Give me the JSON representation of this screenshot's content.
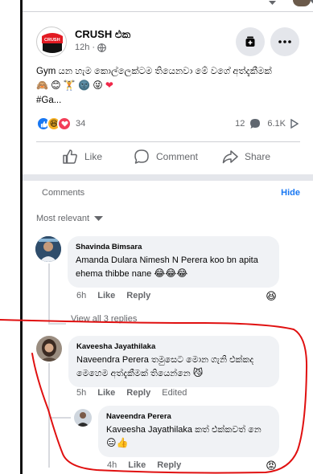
{
  "colors": {
    "accent": "#1877f2",
    "annotation": "#e01010",
    "text": "#050505",
    "muted": "#65676b",
    "bubble": "#f0f2f5"
  },
  "post": {
    "page_name": "CRUSH එක",
    "logo_text": "CRUSH",
    "time": "12h ·",
    "text": "Gym යන හැම කොල්ලෙක්ටම තියෙනවා මේ වගේ අත්දැකීමක්",
    "hashtag": "#Ga...",
    "reaction_count": "34",
    "comment_count": "12",
    "view_count": "6.1K"
  },
  "actions": {
    "like": "Like",
    "comment": "Comment",
    "share": "Share"
  },
  "comments_header": {
    "label": "Comments",
    "hide": "Hide",
    "sort": "Most relevant"
  },
  "comments": [
    {
      "name": "Shavinda Bimsara",
      "text": "Amanda Dulara Nimesh N Perera koo bn apita ehema thibbe nane",
      "time": "6h",
      "like": "Like",
      "reply": "Reply"
    },
    {
      "name": "Kaveesha Jayathilaka",
      "text": "Naveendra Perera තමුසෙට මොන ගැනි එක්කද මෙහෙම අත්දැකීමක් තියෙන්නෙ",
      "time": "5h",
      "like": "Like",
      "reply": "Reply",
      "edited": "Edited"
    },
    {
      "name": "Naveendra Perera",
      "text": "Kaveesha Jayathilaka කත් එක්කවත් නෙ",
      "time": "4h",
      "like": "Like",
      "reply": "Reply"
    }
  ],
  "view_replies": "View all 3 replies"
}
